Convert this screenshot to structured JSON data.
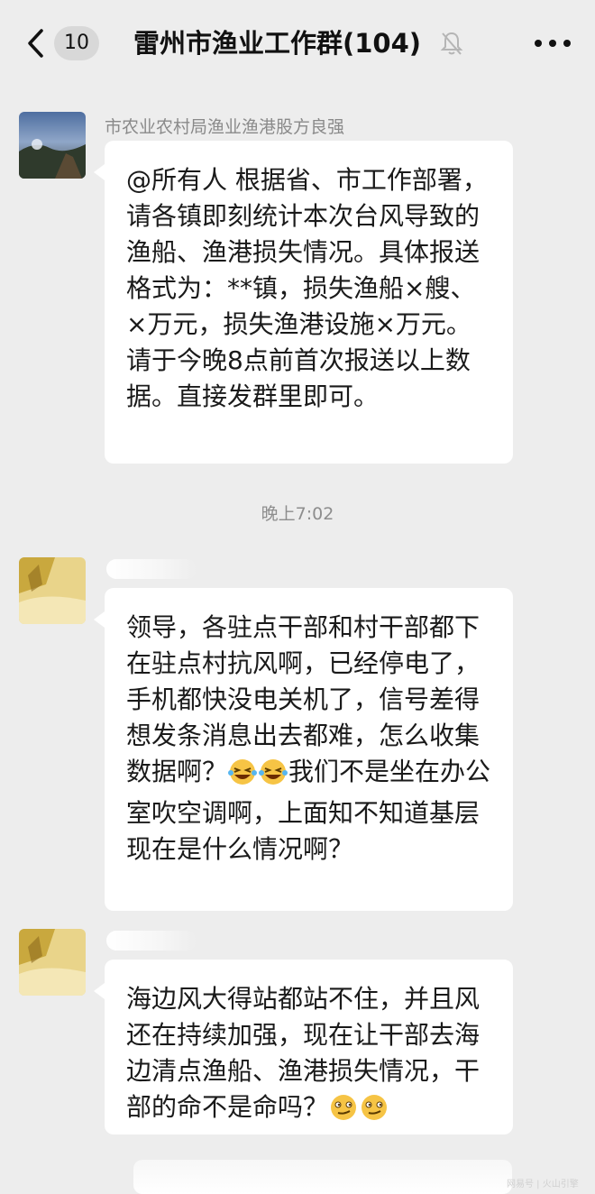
{
  "header": {
    "back_label": "<",
    "unread_count": "10",
    "title": "雷州市渔业工作群(104)",
    "icons": {
      "back": "chevron-left-icon",
      "mute": "muted-bell-icon",
      "more": "more-dots-icon"
    }
  },
  "messages": [
    {
      "sender": "市农业农村局渔业渔港股方良强",
      "text": "@所有人  根据省、市工作部署，请各镇即刻统计本次台风导致的渔船、渔港损失情况。具体报送格式为：**镇，损失渔船×艘、×万元，损失渔港设施×万元。请于今晚8点前首次报送以上数据。直接发群里即可。"
    },
    {
      "text_a": "领导，各驻点干部和村干部都下在驻点村抗风啊，已经停电了，手机都快没电关机了，信号差得想发条消息出去都难，怎么收集数据啊？",
      "emoji": "grinning-squint-tears-emoji",
      "text_b": "我们不是坐在办公室吹空调啊，上面知不知道基层现在是什么情况啊？"
    },
    {
      "text": "海边风大得站都站不住，并且风还在持续加强，现在让干部去海边清点渔船、渔港损失情况，干部的命不是命吗？",
      "emoji": "smirk-face-emoji"
    }
  ],
  "timestamp": "晚上7:02",
  "watermark": "网易号 | 火山引擎",
  "colors": {
    "background": "#ededed",
    "bubble": "#ffffff",
    "text": "#1a1a1a",
    "meta": "#8a8a8a"
  }
}
